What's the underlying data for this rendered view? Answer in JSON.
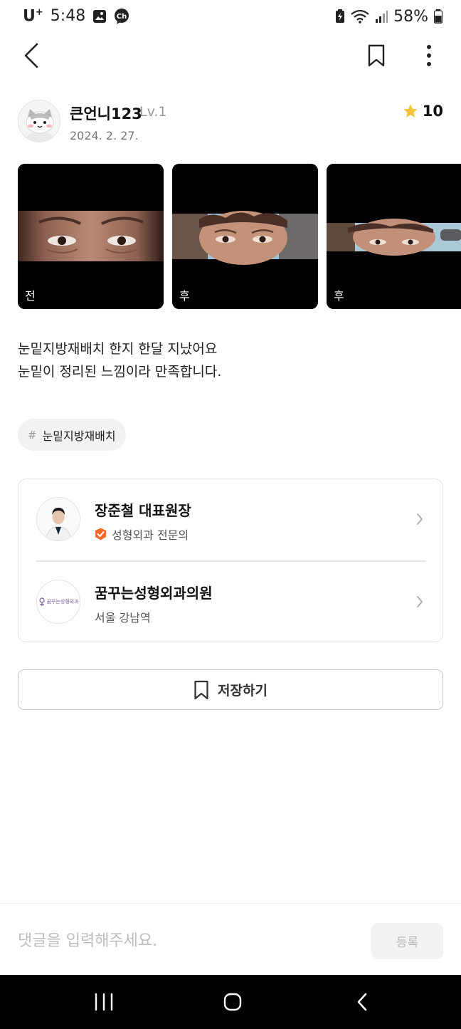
{
  "status_bar": {
    "carrier": "U",
    "carrier_sup": "+",
    "time": "5:48",
    "battery": "58%"
  },
  "author": {
    "name": "큰언니123",
    "level": "Lv.1",
    "date": "2024. 2. 27.",
    "rating": "10"
  },
  "photos": [
    {
      "label": "전"
    },
    {
      "label": "후"
    },
    {
      "label": "후"
    }
  ],
  "review": {
    "line1": "눈밑지방재배치 한지 한달 지났어요",
    "line2": "눈밑이 정리된 느낌이라 만족합니다."
  },
  "tag": {
    "hash": "#",
    "label": "눈밑지방재배치"
  },
  "doctor": {
    "name": "장준철 대표원장",
    "specialty": "성형외과 전문의"
  },
  "clinic": {
    "name": "꿈꾸는성형외과의원",
    "location": "서울 강남역",
    "logo_text": "꿈꾸는성형외과"
  },
  "save_button": {
    "label": "저장하기"
  },
  "comment": {
    "placeholder": "댓글을 입력해주세요.",
    "submit_label": "등록"
  },
  "colors": {
    "star": "#F5C33B",
    "verified_badge": "#F26B2A",
    "accent_text": "#111111"
  }
}
